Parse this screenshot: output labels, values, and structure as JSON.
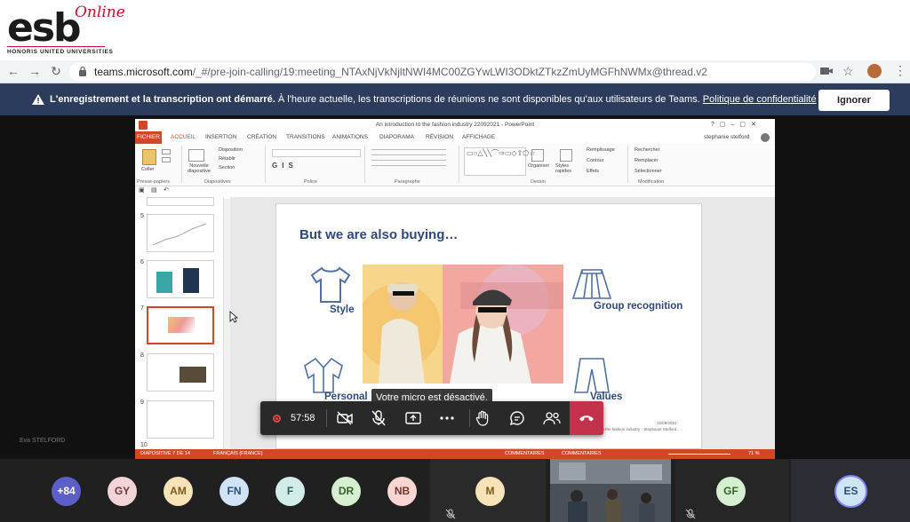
{
  "logo": {
    "main": "esb",
    "online": "Online",
    "subtitle": "HONORIS UNITED UNIVERSITIES"
  },
  "browser": {
    "url_host": "teams.microsoft.com",
    "url_path": "/_#/pre-join-calling/19:meeting_NTAxNjVkNjltNWI4MC00ZGYwLWI3ODktZTkzZmUyMGFhNWMx@thread.v2"
  },
  "banner": {
    "bold_text": "L'enregistrement et la transcription ont démarré.",
    "text": "À l'heure actuelle, les transcriptions de réunions ne sont disponibles qu'aux utilisateurs de Teams.",
    "link": "Politique de confidentialité",
    "ignore_button": "Ignorer"
  },
  "ppt": {
    "window_title": "An introduction to the fashion industry 22092021 - PowerPoint",
    "user": "stephanie stelford",
    "tabs": [
      "FICHIER",
      "ACCUEIL",
      "INSERTION",
      "CRÉATION",
      "TRANSITIONS",
      "ANIMATIONS",
      "DIAPORAMA",
      "RÉVISION",
      "AFFICHAGE"
    ],
    "ribbon": {
      "paste": "Coller",
      "new_slide": "Nouvelle diapositive",
      "disposition": "Disposition",
      "retablir": "Rétablir",
      "section": "Section",
      "organiser": "Organiser",
      "styles": "Styles rapides",
      "remplissage": "Remplissage",
      "contour": "Contour",
      "effets": "Effets",
      "rechercher": "Rechercher",
      "remplacer": "Remplacer",
      "selectionner": "Sélectionner",
      "groups": [
        "Presse-papiers",
        "Diapositives",
        "Police",
        "Paragraphe",
        "Dessin",
        "Modification"
      ]
    },
    "thumb_numbers": [
      "5",
      "6",
      "7",
      "8",
      "9",
      "10"
    ],
    "slide": {
      "title": "But we are also buying…",
      "labels": {
        "style": "Style",
        "group": "Group recognition",
        "personal": "Personal",
        "values": "Values"
      },
      "footer": "An introduction to the fashion industry - Stephanie Stelford",
      "date": "22/09/2021"
    },
    "status": {
      "slide": "DIAPOSITIVE 7 DE 14",
      "lang": "FRANÇAIS (FRANCE)",
      "notes": "COMMENTAIRES",
      "comments": "COMMENTAIRES",
      "zoom": "71 %"
    }
  },
  "toolbar": {
    "time": "57:58",
    "tooltip": "Votre micro est désactivé."
  },
  "presenter_name_blurred": "Eva STELFORD",
  "participants": [
    {
      "initials": "+84",
      "bg": "#5b5fc7",
      "fg": "#ffffff"
    },
    {
      "initials": "GY",
      "bg": "#f2d4d7",
      "fg": "#6b3a42"
    },
    {
      "initials": "AM",
      "bg": "#f8e3b9",
      "fg": "#7a5a1c"
    },
    {
      "initials": "FN",
      "bg": "#cfe4f7",
      "fg": "#2c4f72"
    },
    {
      "initials": "F",
      "bg": "#d2ede9",
      "fg": "#2b5f57"
    },
    {
      "initials": "DR",
      "bg": "#d7efd1",
      "fg": "#38622c"
    },
    {
      "initials": "NB",
      "bg": "#f9d6d2",
      "fg": "#7a342b"
    },
    {
      "initials": "M",
      "bg": "#f8e3b9",
      "fg": "#7a5a1c"
    },
    {
      "initials": "GF",
      "bg": "#d7efd1",
      "fg": "#38622c"
    },
    {
      "initials": "ES",
      "bg": "#cfe4f7",
      "fg": "#2c4f72"
    }
  ]
}
